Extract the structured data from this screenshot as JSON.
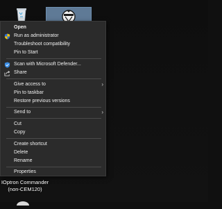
{
  "desktop": {
    "recycle_bin_icon": "recycle-bin-icon",
    "selected_app_icon": "app-helmet-icon",
    "selection_color": "#5f7a96",
    "label_line1": "IOptron Commander",
    "label_line2": "(non-CEM120)"
  },
  "menu": {
    "items": [
      {
        "label": "Open",
        "bold": true
      },
      {
        "label": "Run as administrator",
        "icon": "uac-shield-icon"
      },
      {
        "label": "Troubleshoot compatibility"
      },
      {
        "label": "Pin to Start"
      },
      {
        "label": "Scan with Microsoft Defender...",
        "icon": "defender-shield-icon"
      },
      {
        "label": "Share",
        "icon": "share-icon"
      },
      {
        "label": "Give access to",
        "submenu": true
      },
      {
        "label": "Pin to taskbar"
      },
      {
        "label": "Restore previous versions"
      },
      {
        "label": "Send to",
        "submenu": true
      },
      {
        "label": "Cut"
      },
      {
        "label": "Copy"
      },
      {
        "label": "Create shortcut"
      },
      {
        "label": "Delete"
      },
      {
        "label": "Rename"
      },
      {
        "label": "Properties"
      }
    ],
    "chevron": "›",
    "background": "#2b2b2b",
    "text_color": "#f1f1f1"
  }
}
